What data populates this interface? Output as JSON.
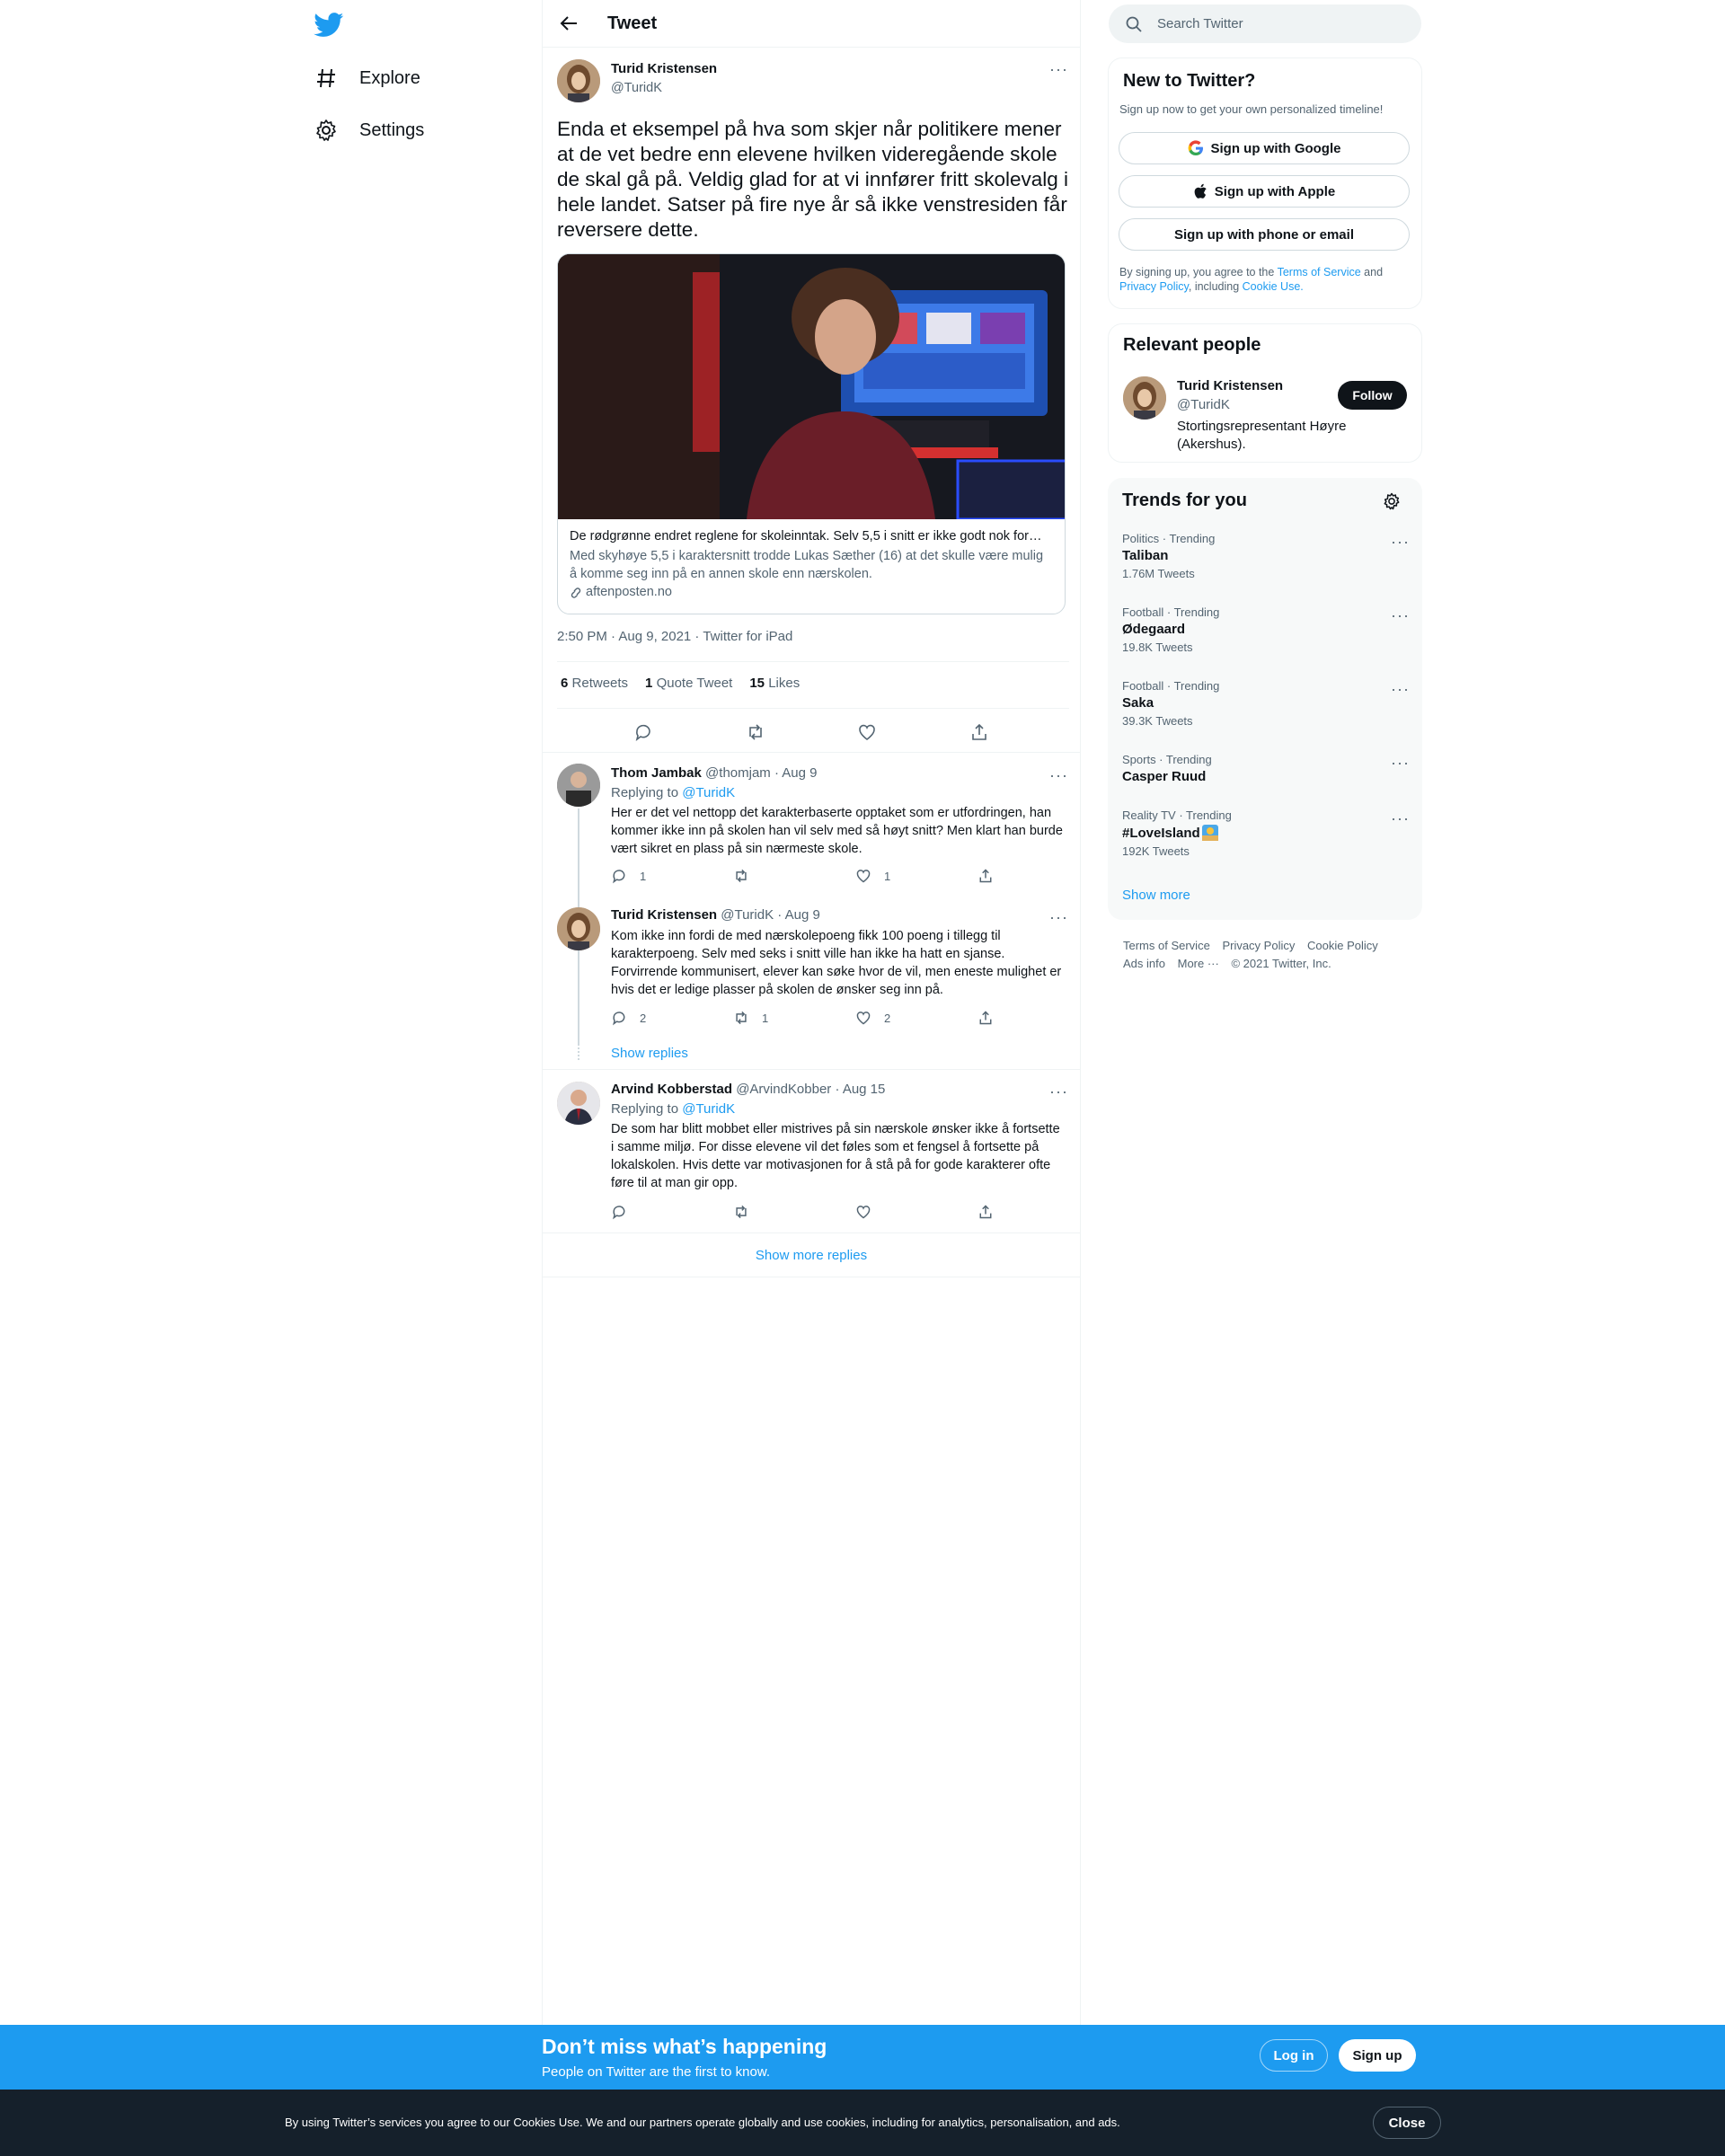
{
  "nav": {
    "items": [
      {
        "label": "Explore",
        "icon": "hashtag-icon"
      },
      {
        "label": "Settings",
        "icon": "gear-icon"
      }
    ]
  },
  "header": {
    "title": "Tweet"
  },
  "tweet": {
    "author_name": "Turid Kristensen",
    "author_handle": "@TuridK",
    "text": "Enda et eksempel på hva som skjer når politikere mener at de vet bedre enn elevene hvilken videregående skole de skal gå på. Veldig glad for at vi innfører fritt skolevalg i hele landet. Satser på fire nye år så ikke venstresiden får reversere dette.",
    "card": {
      "title": "De rødgrønne endret reglene for skoleinntak. Selv 5,5 i snitt er ikke godt nok for…",
      "description": "Med skyhøye 5,5 i karaktersnitt trodde Lukas Sæther (16) at det skulle være mulig å komme seg inn på en annen skole enn nærskolen.",
      "domain": "aftenposten.no"
    },
    "timestamp": "2:50 PM · Aug 9, 2021 · Twitter for iPad",
    "stats": {
      "retweets": "6",
      "retweets_label": "Retweets",
      "quotes": "1",
      "quotes_label": "Quote Tweet",
      "likes": "15",
      "likes_label": "Likes"
    }
  },
  "replies": [
    {
      "name": "Thom Jambak",
      "handle": "@thomjam",
      "date": "· Aug 9",
      "replying_prefix": "Replying to",
      "replying_to": "@TuridK",
      "text": "Her er det vel nettopp det karakterbaserte opptaket som er utfordringen, han kommer ikke inn på skolen han vil selv med så høyt snitt? Men klart han burde vært sikret en plass på sin nærmeste skole.",
      "replies": "1",
      "retweets": "",
      "likes": "1"
    },
    {
      "name": "Turid Kristensen",
      "handle": "@TuridK",
      "date": "· Aug 9",
      "text": "Kom ikke inn fordi de med nærskolepoeng fikk 100 poeng i tillegg til karakterpoeng. Selv med seks i snitt ville han ikke ha hatt en sjanse. Forvirrende kommunisert, elever kan søke hvor de vil, men eneste mulighet er hvis det er ledige plasser på skolen de ønsker seg inn på.",
      "replies": "2",
      "retweets": "1",
      "likes": "2",
      "show_replies": "Show replies"
    },
    {
      "name": "Arvind Kobberstad",
      "handle": "@ArvindKobber",
      "date": "· Aug 15",
      "replying_prefix": "Replying to",
      "replying_to": "@TuridK",
      "text": "De som har blitt mobbet eller mistrives på sin nærskole ønsker ikke å fortsette i samme miljø. For disse elevene vil det føles som et fengsel å fortsette på lokalskolen. Hvis dette var motivasjonen for å stå på for gode karakterer ofte føre til at man gir opp.",
      "replies": "",
      "retweets": "",
      "likes": ""
    }
  ],
  "show_more_replies": "Show more replies",
  "search": {
    "placeholder": "Search Twitter"
  },
  "signup": {
    "title": "New to Twitter?",
    "subtitle": "Sign up now to get your own personalized timeline!",
    "google": "Sign up with Google",
    "apple": "Sign up with Apple",
    "phone": "Sign up with phone or email",
    "legal_1": "By signing up, you agree to the",
    "tos": "Terms of Service",
    "legal_2": "and",
    "privacy": "Privacy Policy",
    "legal_3": ", including",
    "cookie": "Cookie Use."
  },
  "relevant": {
    "title": "Relevant people",
    "name": "Turid Kristensen",
    "handle": "@TuridK",
    "bio": "Stortingsrepresentant Høyre (Akershus).",
    "follow": "Follow"
  },
  "trends": {
    "title": "Trends for you",
    "items": [
      {
        "context": "Politics · Trending",
        "name": "Taliban",
        "count": "1.76M Tweets"
      },
      {
        "context": "Football · Trending",
        "name": "Ødegaard",
        "count": "19.8K Tweets"
      },
      {
        "context": "Football · Trending",
        "name": "Saka",
        "count": "39.3K Tweets"
      },
      {
        "context": "Sports · Trending",
        "name": "Casper Ruud",
        "count": ""
      },
      {
        "context": "Reality TV · Trending",
        "name": "#LoveIsland",
        "count": "192K Tweets"
      }
    ],
    "show_more": "Show more"
  },
  "footer": {
    "tos": "Terms of Service",
    "privacy": "Privacy Policy",
    "cookie": "Cookie Policy",
    "ads": "Ads info",
    "more": "More ···",
    "copyright": "© 2021 Twitter, Inc."
  },
  "banner": {
    "title": "Don’t miss what’s happening",
    "subtitle": "People on Twitter are the first to know.",
    "login": "Log in",
    "signup": "Sign up"
  },
  "cookie_bar": {
    "text": "By using Twitter’s services you agree to our Cookies Use. We and our partners operate globally and use cookies, including for analytics, personalisation, and ads.",
    "close": "Close"
  },
  "colors": {
    "accent": "#1d9bf0",
    "text": "#0f1419",
    "muted": "#536471",
    "cookie_bg": "#15202b"
  }
}
